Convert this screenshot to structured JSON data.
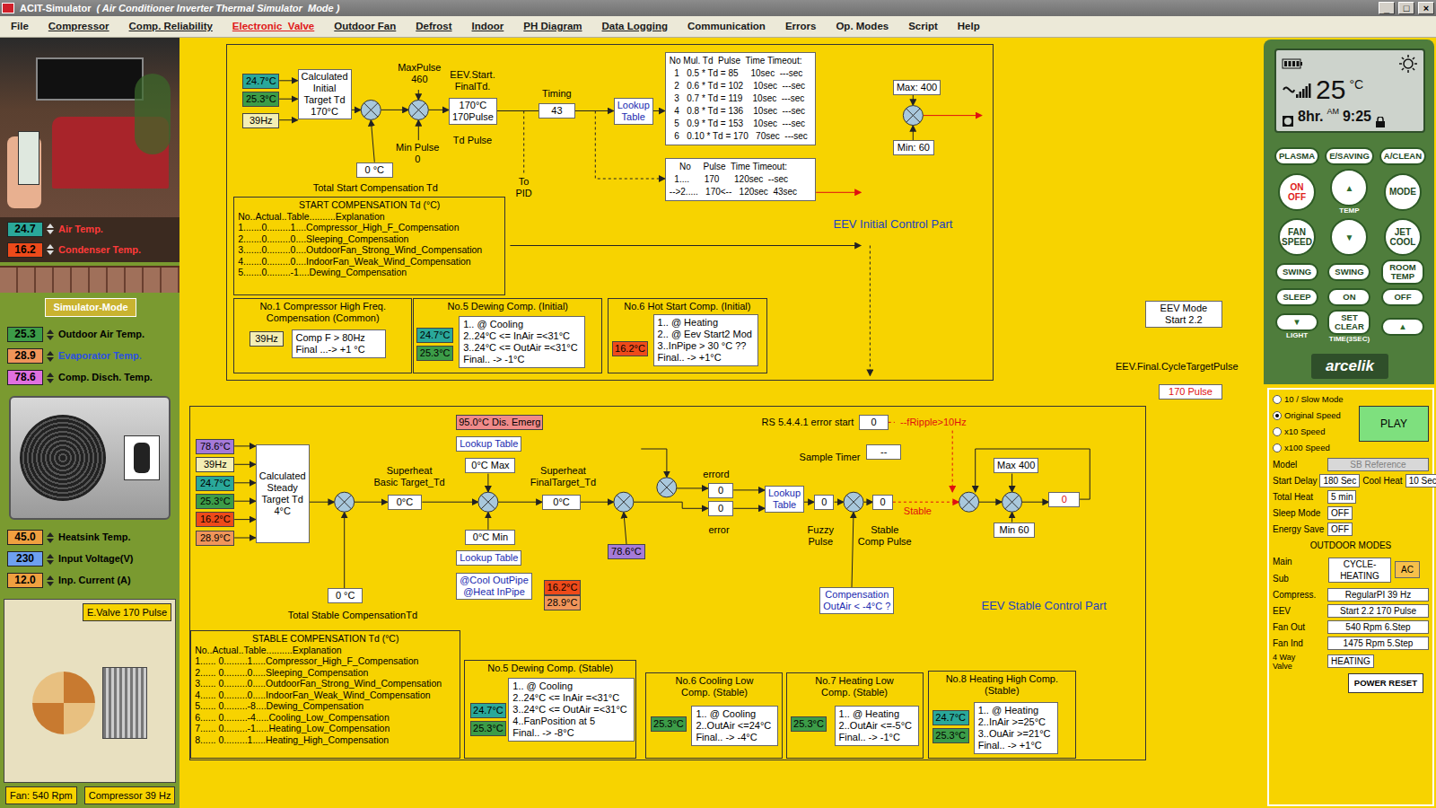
{
  "title_bar": {
    "app": "ACIT-Simulator",
    "mode": "( Air Conditioner Inverter Thermal Simulator  Mode )",
    "buttons": [
      "_",
      "□",
      "×"
    ]
  },
  "menu": [
    {
      "label": "File",
      "underlined": false,
      "selected": false
    },
    {
      "label": "Compressor",
      "underlined": true,
      "selected": false
    },
    {
      "label": "Comp. Reliability",
      "underlined": true,
      "selected": false
    },
    {
      "label": "Electronic  Valve",
      "underlined": true,
      "selected": true
    },
    {
      "label": "Outdoor Fan",
      "underlined": true,
      "selected": false
    },
    {
      "label": "Defrost",
      "underlined": true,
      "selected": false
    },
    {
      "label": "Indoor",
      "underlined": true,
      "selected": false
    },
    {
      "label": "PH Diagram",
      "underlined": true,
      "selected": false
    },
    {
      "label": "Data Logging",
      "underlined": true,
      "selected": false
    },
    {
      "label": "Communication",
      "underlined": false,
      "selected": false
    },
    {
      "label": "Errors",
      "underlined": false,
      "selected": false
    },
    {
      "label": "Op. Modes",
      "underlined": false,
      "selected": false
    },
    {
      "label": "Script",
      "underlined": false,
      "selected": false
    },
    {
      "label": "Help",
      "underlined": false,
      "selected": false
    }
  ],
  "left": {
    "room_fields": [
      {
        "value": "24.7",
        "label": "Air Temp.",
        "color": "#2aa89a",
        "label_color": "#ff3a3a"
      },
      {
        "value": "16.2",
        "label": "Condenser Temp.",
        "color": "#ee4a1a",
        "label_color": "#ff3a3a"
      }
    ],
    "mode_label": "Simulator-Mode",
    "temps": [
      {
        "value": "25.3",
        "label": "Outdoor Air Temp.",
        "color": "#3c9c48",
        "label_color": "#000000"
      },
      {
        "value": "28.9",
        "label": "Evaporator Temp.",
        "color": "#f0955a",
        "label_color": "#2a50e0"
      },
      {
        "value": "78.6",
        "label": "Comp. Disch. Temp.",
        "color": "#e070e0",
        "label_color": "#000000"
      }
    ],
    "electrical": [
      {
        "value": "45.0",
        "label": "Heatsink Temp.",
        "color": "#f0a040",
        "label_color": "#000000"
      },
      {
        "value": "230",
        "label": "Input Voltage(V)",
        "color": "#6ea0f0",
        "label_color": "#000000"
      },
      {
        "value": "12.0",
        "label": "Inp. Current (A)",
        "color": "#f0a040",
        "label_color": "#000000"
      }
    ],
    "valve_label": "E.Valve 170 Pulse",
    "fan": "Fan: 540 Rpm",
    "compressor": "Compressor 39 Hz"
  },
  "diagram": {
    "frame_initial": {
      "kind": "frame",
      "lines": []
    },
    "frame_stable": {
      "kind": "frame",
      "lines": []
    },
    "comp1_frame": {
      "kind": "frame",
      "lines": [
        "No.1 Compressor High  Freq.",
        "Compensation (Common)"
      ]
    },
    "dew_i_frame": {
      "kind": "frame",
      "lines": [
        "No.5 Dewing Comp. (Initial)"
      ]
    },
    "hot_frame": {
      "kind": "frame",
      "lines": [
        "No.6 Hot Start Comp. (Initial)"
      ]
    },
    "dew_s_frame": {
      "kind": "frame",
      "lines": [
        "No.5 Dewing Comp. (Stable)"
      ]
    },
    "cool_low_frame": {
      "kind": "frame",
      "lines": [
        "No.6 Cooling Low",
        "Comp. (Stable)"
      ]
    },
    "heat_low_frame": {
      "kind": "frame",
      "lines": [
        "No.7 Heating Low",
        "Comp. (Stable)"
      ]
    },
    "heat_high_frame": {
      "kind": "frame",
      "lines": [
        "No.8 Heating High  Comp.",
        "(Stable)"
      ]
    },
    "init_in_inair": {
      "kind": "chip",
      "lines": [
        "24.7°C"
      ],
      "color": "#2aa89a"
    },
    "init_in_outair": {
      "kind": "chip",
      "lines": [
        "25.3°C"
      ],
      "color": "#3c9c48"
    },
    "init_in_freq": {
      "kind": "chip",
      "lines": [
        "39Hz"
      ],
      "color": "#f4eeb4"
    },
    "calc_initial": {
      "kind": "box",
      "lines": [
        "Calculated",
        "Initial",
        "Target Td",
        "170°C"
      ]
    },
    "max_pulse": {
      "kind": "label",
      "lines": [
        "MaxPulse",
        "460"
      ]
    },
    "min_pulse": {
      "kind": "label",
      "lines": [
        "Min Pulse",
        "0"
      ]
    },
    "start_comp_value": {
      "kind": "box",
      "lines": [
        "0 °C"
      ]
    },
    "start_comp_label": {
      "kind": "label",
      "lines": [
        "Total Start Compensation Td"
      ]
    },
    "eev_start_label": {
      "kind": "label",
      "lines": [
        "EEV.Start.",
        "FinalTd."
      ]
    },
    "eev_start_value": {
      "kind": "box",
      "lines": [
        "170°C",
        "170Pulse"
      ]
    },
    "td_pulse_label": {
      "kind": "label",
      "lines": [
        "Td Pulse"
      ]
    },
    "timing_label": {
      "kind": "label",
      "lines": [
        "Timing"
      ]
    },
    "timing_value": {
      "kind": "box",
      "lines": [
        "43"
      ]
    },
    "to_pid": {
      "kind": "label",
      "lines": [
        "To",
        "PID"
      ]
    },
    "init_lookup": {
      "kind": "box",
      "lines": [
        "Lookup",
        "Table"
      ],
      "color": "#1a2ab0"
    },
    "pulse_table": {
      "kind": "table",
      "lines": [
        "No Mul. Td  Pulse  Time Timeout:",
        "  1   0.5 * Td = 85     10sec  ---sec",
        "  2   0.6 * Td = 102    10sec  ---sec",
        "  3   0.7 * Td = 119    10sec  ---sec",
        "  4   0.8 * Td = 136    10sec  ---sec",
        "  5   0.9 * Td = 153    10sec  ---sec",
        "  6   0.10 * Td = 170   70sec  ---sec"
      ]
    },
    "step_table": {
      "kind": "table",
      "lines": [
        "    No     Pulse  Time Timeout:",
        "  1....      170      120sec  --sec",
        "-->2.....   170<--   120sec  43sec"
      ]
    },
    "init_max": {
      "kind": "box",
      "lines": [
        "Max: 400"
      ]
    },
    "init_min": {
      "kind": "box",
      "lines": [
        "Min: 60"
      ]
    },
    "init_title": {
      "kind": "heading",
      "lines": [
        "EEV Initial Control Part"
      ],
      "color": "#2040c0"
    },
    "start_comp": {
      "kind": "list",
      "lines": [
        "START COMPENSATION Td (°C)",
        "No..Actual..Table..........Explanation",
        "1.......0.........1....Compressor_High_F_Compensation",
        "2.......0.........0....Sleeping_Compensation",
        "3.......0.........0....OutdoorFan_Strong_Wind_Compensation",
        "4.......0.........0....IndoorFan_Weak_Wind_Compensation",
        "5.......0.........-1....Dewing_Compensation"
      ]
    },
    "comp1_chip": {
      "kind": "chip",
      "lines": [
        "39Hz"
      ],
      "color": "#f4eeb4"
    },
    "comp1_box": {
      "kind": "note",
      "lines": [
        "Comp F > 80Hz",
        "Final ...-> +1 °C"
      ]
    },
    "dew_i_chip1": {
      "kind": "chip",
      "lines": [
        "24.7°C"
      ],
      "color": "#2aa89a"
    },
    "dew_i_chip2": {
      "kind": "chip",
      "lines": [
        "25.3°C"
      ],
      "color": "#3c9c48"
    },
    "dew_i_note": {
      "kind": "note",
      "lines": [
        "1.. @ Cooling",
        "2..24°C <= InAir  =<31°C",
        "3..24°C <= OutAir =<31°C",
        "Final.. -> -1°C"
      ]
    },
    "hot_chip": {
      "kind": "chip",
      "lines": [
        "16.2°C"
      ],
      "color": "#ee4a1a"
    },
    "hot_note": {
      "kind": "note",
      "lines": [
        "1.. @ Heating",
        "2.. @ Eev Start2 Mod",
        "3..InPipe > 30 °C ??",
        "Final.. -> +1°C"
      ]
    },
    "eev_mode": {
      "kind": "box",
      "lines": [
        "EEV Mode",
        "Start 2.2"
      ]
    },
    "final_pulse_label": {
      "kind": "label",
      "lines": [
        "EEV.Final.CycleTargetPulse"
      ]
    },
    "final_pulse_value": {
      "kind": "box",
      "lines": [
        "170 Pulse"
      ],
      "color": "#e01010"
    },
    "st_in_disch": {
      "kind": "chip",
      "lines": [
        "78.6°C"
      ],
      "color": "#a57ad8"
    },
    "st_in_freq": {
      "kind": "chip",
      "lines": [
        "39Hz"
      ],
      "color": "#f4eeb4"
    },
    "st_in_inair": {
      "kind": "chip",
      "lines": [
        "24.7°C"
      ],
      "color": "#2aa89a"
    },
    "st_in_outair": {
      "kind": "chip",
      "lines": [
        "25.3°C"
      ],
      "color": "#3c9c48"
    },
    "st_in_inpipe": {
      "kind": "chip",
      "lines": [
        "16.2°C"
      ],
      "color": "#ee4a1a"
    },
    "st_in_outpipe": {
      "kind": "chip",
      "lines": [
        "28.9°C"
      ],
      "color": "#f0955a"
    },
    "calc_steady": {
      "kind": "box",
      "lines": [
        "Calculated",
        "Steady",
        "Target Td",
        "4°C"
      ]
    },
    "sh_basic_label": {
      "kind": "label",
      "lines": [
        "Superheat",
        "Basic Target_Td"
      ]
    },
    "sh_basic_value": {
      "kind": "box",
      "lines": [
        "0°C"
      ]
    },
    "dis_emerg": {
      "kind": "chip",
      "lines": [
        "95.0°C Dis. Emerg"
      ],
      "color": "#f08a8a"
    },
    "lookup_max": {
      "kind": "box",
      "lines": [
        "Lookup Table"
      ],
      "color": "#1a2ab0"
    },
    "max_value": {
      "kind": "box",
      "lines": [
        "0°C Max"
      ]
    },
    "min_value": {
      "kind": "box",
      "lines": [
        "0°C Min"
      ]
    },
    "lookup_min": {
      "kind": "box",
      "lines": [
        "Lookup Table"
      ],
      "color": "#1a2ab0"
    },
    "pipe_select": {
      "kind": "box",
      "lines": [
        "@Cool OutPipe",
        "@Heat InPipe"
      ],
      "color": "#1a2ab0"
    },
    "pipe_chip1": {
      "kind": "chip",
      "lines": [
        "16.2°C"
      ],
      "color": "#ee4a1a"
    },
    "pipe_chip2": {
      "kind": "chip",
      "lines": [
        "28.9°C"
      ],
      "color": "#f0955a"
    },
    "sh_final_label": {
      "kind": "label",
      "lines": [
        "Superheat",
        "FinalTarget_Td"
      ]
    },
    "sh_final_value": {
      "kind": "box",
      "lines": [
        "0°C"
      ]
    },
    "disch_chip": {
      "kind": "chip",
      "lines": [
        "78.6°C"
      ],
      "color": "#a57ad8"
    },
    "errord_label": {
      "kind": "label",
      "lines": [
        "errord"
      ]
    },
    "errord_value": {
      "kind": "box",
      "lines": [
        "0"
      ]
    },
    "error_value": {
      "kind": "box",
      "lines": [
        "0"
      ]
    },
    "error_label": {
      "kind": "label",
      "lines": [
        "error"
      ]
    },
    "fuzzy_lookup": {
      "kind": "box",
      "lines": [
        "Lookup",
        "Table"
      ],
      "color": "#1a2ab0"
    },
    "fuzzy_value": {
      "kind": "box",
      "lines": [
        "0"
      ]
    },
    "fuzzy_label": {
      "kind": "label",
      "lines": [
        "Fuzzy",
        "Pulse"
      ]
    },
    "stable_value": {
      "kind": "box",
      "lines": [
        "0"
      ]
    },
    "stable_comp_label": {
      "kind": "label",
      "lines": [
        "Stable",
        "Comp Pulse"
      ]
    },
    "stable_flag": {
      "kind": "label",
      "lines": [
        "Stable"
      ],
      "color": "#e01010"
    },
    "outair_check": {
      "kind": "box",
      "lines": [
        "Compensation",
        "OutAir < -4°C ?"
      ],
      "color": "#1a2ab0"
    },
    "rs_label": {
      "kind": "label",
      "lines": [
        "RS 5.4.4.1 error start"
      ]
    },
    "rs_value": {
      "kind": "box",
      "lines": [
        "0"
      ]
    },
    "ripple_label": {
      "kind": "label",
      "lines": [
        "--fRipple>10Hz"
      ],
      "color": "#e01010"
    },
    "sample_label": {
      "kind": "label",
      "lines": [
        "Sample Timer"
      ]
    },
    "sample_value": {
      "kind": "box",
      "lines": [
        "--"
      ]
    },
    "st_max": {
      "kind": "box",
      "lines": [
        "Max 400"
      ]
    },
    "st_min": {
      "kind": "box",
      "lines": [
        "Min 60"
      ]
    },
    "st_out": {
      "kind": "box",
      "lines": [
        "0"
      ],
      "color": "#e01010"
    },
    "stable_comp_value": {
      "kind": "box",
      "lines": [
        "0 °C"
      ]
    },
    "stable_comp_label2": {
      "kind": "label",
      "lines": [
        "Total Stable CompensationTd"
      ]
    },
    "stable_title": {
      "kind": "heading",
      "lines": [
        "EEV Stable Control  Part"
      ],
      "color": "#2040c0"
    },
    "stable_comp": {
      "kind": "list",
      "lines": [
        "STABLE COMPENSATION Td (°C)",
        "No..Actual..Table..........Explanation",
        "1...... 0.........1.....Compressor_High_F_Compensation",
        "2...... 0.........0.....Sleeping_Compensation",
        "3...... 0.........0.....OutdoorFan_Strong_Wind_Compensation",
        "4...... 0.........0.....IndoorFan_Weak_Wind_Compensation",
        "5...... 0.........-8....Dewing_Compensation",
        "6...... 0.........-4.....Cooling_Low_Compensation",
        "7...... 0.........-1.....Heating_Low_Compensation",
        "8...... 0.........1.....Heating_High_Compensation"
      ]
    },
    "dew_s_chip1": {
      "kind": "chip",
      "lines": [
        "24.7°C"
      ],
      "color": "#2aa89a"
    },
    "dew_s_chip2": {
      "kind": "chip",
      "lines": [
        "25.3°C"
      ],
      "color": "#3c9c48"
    },
    "dew_s_note": {
      "kind": "note",
      "lines": [
        "1.. @ Cooling",
        "2..24°C <= InAir  =<31°C",
        "3..24°C <= OutAir =<31°C",
        "4..FanPosition at 5",
        "Final.. -> -8°C"
      ]
    },
    "cool_low_chip": {
      "kind": "chip",
      "lines": [
        "25.3°C"
      ],
      "color": "#3c9c48"
    },
    "cool_low_note": {
      "kind": "note",
      "lines": [
        "1.. @ Cooling",
        "2..OutAir <=24°C",
        "Final.. -> -4°C"
      ]
    },
    "heat_low_chip": {
      "kind": "chip",
      "lines": [
        "25.3°C"
      ],
      "color": "#3c9c48"
    },
    "heat_low_note": {
      "kind": "note",
      "lines": [
        "1.. @ Heating",
        "2..OutAir <=-5°C",
        "Final.. -> -1°C"
      ]
    },
    "heat_high_chip1": {
      "kind": "chip",
      "lines": [
        "24.7°C"
      ],
      "color": "#2aa89a"
    },
    "heat_high_chip2": {
      "kind": "chip",
      "lines": [
        "25.3°C"
      ],
      "color": "#3c9c48"
    },
    "heat_high_note": {
      "kind": "note",
      "lines": [
        "1.. @ Heating",
        "2..InAir >=25°C",
        "3..OuAir >=21°C",
        "Final.. -> +1°C"
      ]
    }
  },
  "remote": {
    "display": {
      "temp": "25",
      "unit": "°C",
      "timer": "8hr.",
      "ampm": "AM",
      "clock": "9:25"
    },
    "buttons": [
      {
        "lines": [
          "PLASMA"
        ],
        "kind": "pill",
        "color": "#1f4a1f",
        "caption": ""
      },
      {
        "lines": [
          "E/SAVING"
        ],
        "kind": "pill",
        "color": "#1f4a1f",
        "caption": ""
      },
      {
        "lines": [
          "A/CLEAN"
        ],
        "kind": "pill",
        "color": "#1f4a1f",
        "caption": ""
      },
      {
        "lines": [
          "ON",
          "OFF"
        ],
        "kind": "round",
        "color": "#e0201a",
        "caption": ""
      },
      {
        "lines": [
          "▲"
        ],
        "kind": "round",
        "color": "#2d6a2d",
        "caption": "TEMP"
      },
      {
        "lines": [
          "MODE"
        ],
        "kind": "round",
        "color": "#1f4a1f",
        "caption": ""
      },
      {
        "lines": [
          "FAN",
          "SPEED"
        ],
        "kind": "round",
        "color": "#1f4a1f",
        "caption": ""
      },
      {
        "lines": [
          "▼"
        ],
        "kind": "round",
        "color": "#2d6a2d",
        "caption": ""
      },
      {
        "lines": [
          "JET",
          "COOL"
        ],
        "kind": "round",
        "color": "#1f4a1f",
        "caption": ""
      },
      {
        "lines": [
          "SWING"
        ],
        "kind": "pill",
        "color": "#1f4a1f",
        "caption": ""
      },
      {
        "lines": [
          "SWING"
        ],
        "kind": "pill",
        "color": "#1f4a1f",
        "caption": ""
      },
      {
        "lines": [
          "ROOM",
          "TEMP"
        ],
        "kind": "pill",
        "color": "#1f4a1f",
        "caption": ""
      },
      {
        "lines": [
          "SLEEP"
        ],
        "kind": "pill",
        "color": "#1f4a1f",
        "caption": ""
      },
      {
        "lines": [
          "ON"
        ],
        "kind": "pill",
        "color": "#1f4a1f",
        "caption": ""
      },
      {
        "lines": [
          "OFF"
        ],
        "kind": "pill",
        "color": "#1f4a1f",
        "caption": ""
      },
      {
        "lines": [
          "▼"
        ],
        "kind": "pill",
        "color": "#2d6a2d",
        "caption": "LIGHT"
      },
      {
        "lines": [
          "SET",
          "CLEAR"
        ],
        "kind": "pill",
        "color": "#1f4a1f",
        "caption": "TIME(3SEC)"
      },
      {
        "lines": [
          "▲"
        ],
        "kind": "pill",
        "color": "#2d6a2d",
        "caption": ""
      }
    ],
    "logo": "arcelik"
  },
  "settings": {
    "speed_options": [
      {
        "label": "10 / Slow Mode",
        "selected": false
      },
      {
        "label": "Original Speed",
        "selected": true
      },
      {
        "label": "x10 Speed",
        "selected": false
      },
      {
        "label": "x100 Speed",
        "selected": false
      }
    ],
    "play": "PLAY",
    "model": {
      "label": "Model",
      "value": "SB Reference",
      "disabled": true
    },
    "start_delay": {
      "label": "Start Delay",
      "value": "180 Sec"
    },
    "cool_heat": {
      "label": "Cool Heat",
      "value": "10 Sec"
    },
    "fields": [
      {
        "label": "Total Heat",
        "value": "5 min"
      },
      {
        "label": "Sleep Mode",
        "value": "OFF"
      },
      {
        "label": "Energy Save",
        "value": "OFF"
      }
    ],
    "outdoor_modes": "OUTDOOR MODES",
    "main_label": "Main",
    "main_value": [
      "CYCLE-",
      "HEATING"
    ],
    "sub_label": "Sub",
    "sub_value": "AC",
    "status": [
      {
        "label": "Compress.",
        "value": "RegularPI   39 Hz"
      },
      {
        "label": "EEV",
        "value": "Start 2.2  170 Pulse"
      },
      {
        "label": "Fan Out",
        "value": "540 Rpm  6.Step"
      },
      {
        "label": "Fan Ind",
        "value": "1475 Rpm  5.Step"
      }
    ],
    "valve_label": [
      "4 Way",
      "Valve"
    ],
    "valve_value": "HEATING",
    "reset": "POWER RESET"
  }
}
